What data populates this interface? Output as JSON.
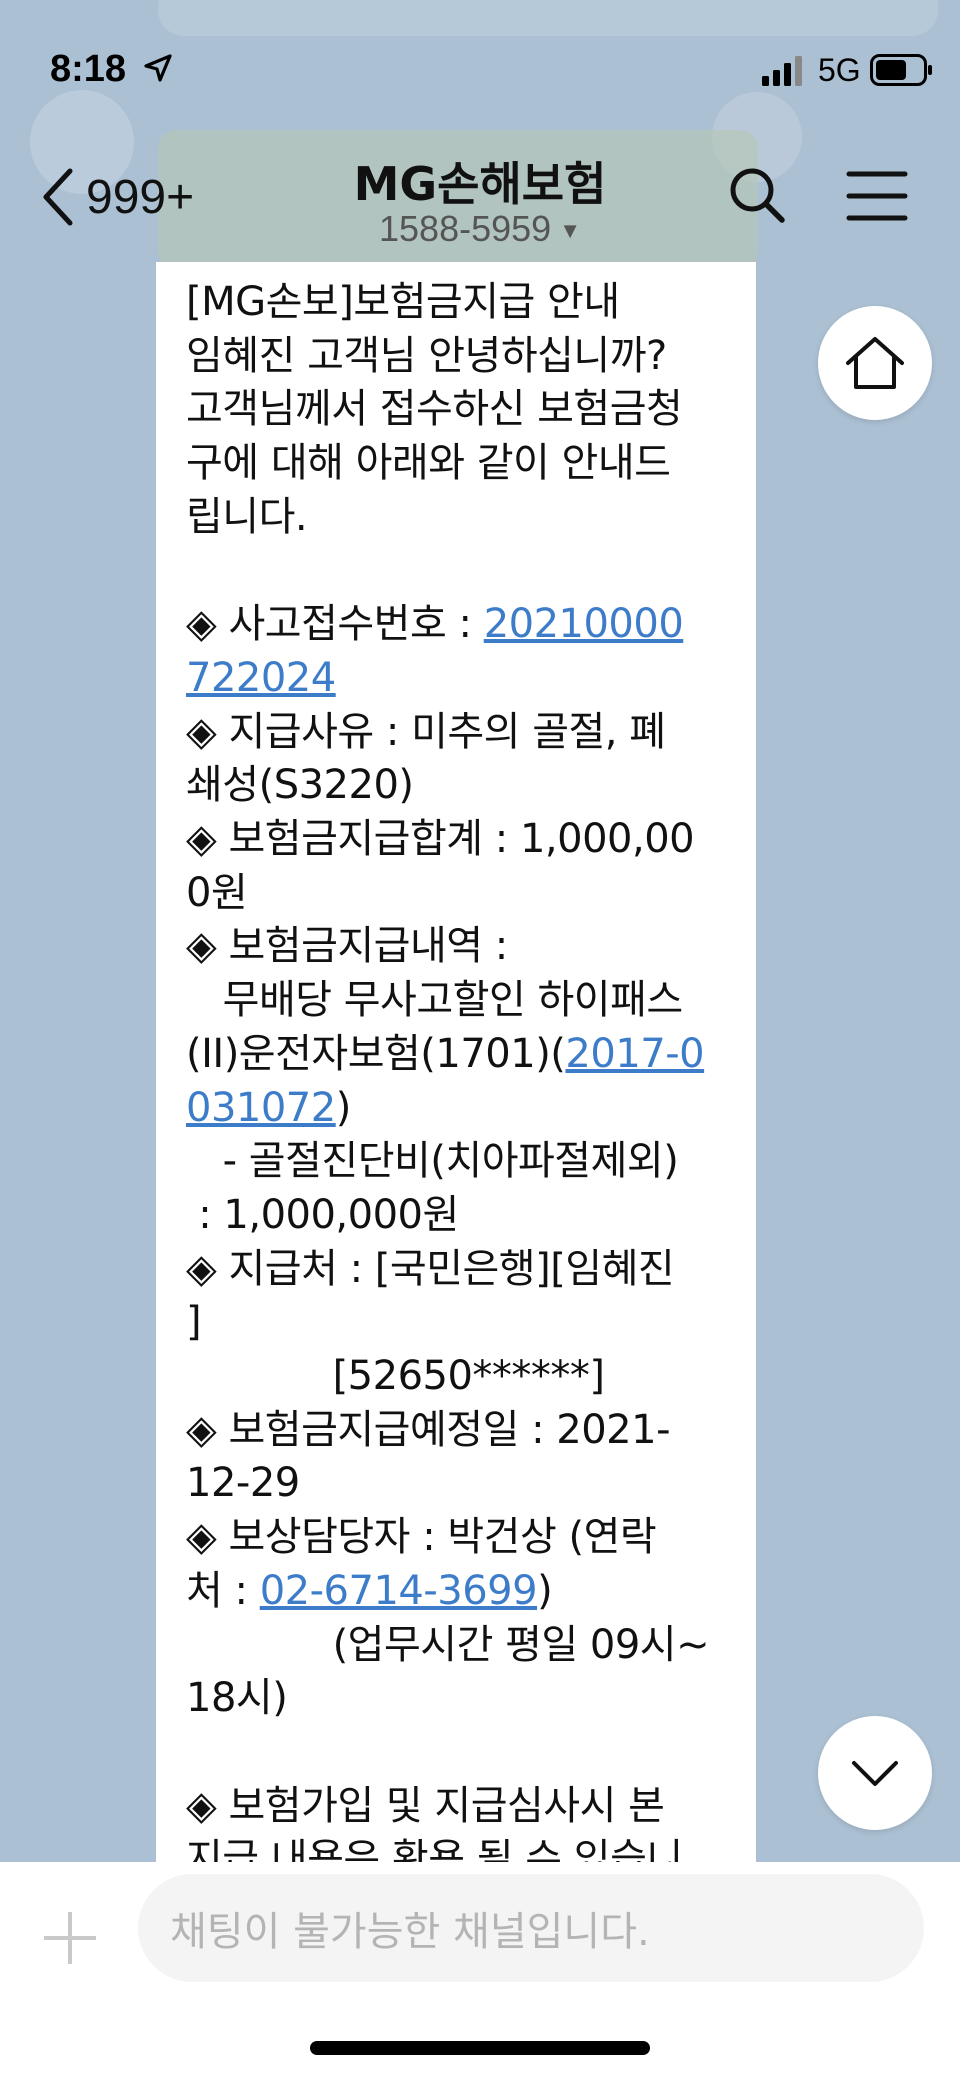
{
  "status_bar": {
    "time": "8:18",
    "network": "5G"
  },
  "header": {
    "back_count": "999+",
    "title": "MG손해보험",
    "phone": "1588-5959"
  },
  "message": {
    "l01": "[MG손보]보험금지급 안내",
    "l02": "임혜진 고객님 안녕하십니까?",
    "l03": "고객님께서 접수하신 보험금청",
    "l04": "구에 대해 아래와 같이 안내드",
    "l05": "립니다.",
    "l07_label": "◈ 사고접수번호 : ",
    "l07_link": "20210000",
    "l08_link": "722024",
    "l09": "◈ 지급사유 : 미추의 골절, 폐",
    "l10": "쇄성(S3220)",
    "l11": "◈ 보험금지급합계 : 1,000,00",
    "l12": "0원",
    "l13": "◈ 보험금지급내역 :",
    "l14": "   무배당 무사고할인 하이패스",
    "l15_text": "(II)운전자보험(1701)(",
    "l15_link": "2017-0",
    "l16_link": "031072",
    "l16_text": ")",
    "l17": "   - 골절진단비(치아파절제외)",
    "l18": " : 1,000,000원",
    "l19": "◈ 지급처 : [국민은행][임혜진",
    "l20": "]",
    "l21": "            [52650******]",
    "l22": "◈ 보험금지급예정일 : 2021-",
    "l23": "12-29",
    "l24": "◈ 보상담당자 : 박건상 (연락",
    "l25_text": "처 : ",
    "l25_link": "02-6714-3699",
    "l25_end": ")",
    "l26": "            (업무시간 평일 09시~",
    "l27": "18시)",
    "l29": "◈ 보험가입 및 지급심사시 본",
    "l30": "지급 내용은 확용 될 수 있습니"
  },
  "input": {
    "placeholder": "채팅이 불가능한 채널입니다."
  },
  "colors": {
    "background": "#abc0d3",
    "link": "#3d7cc9"
  }
}
